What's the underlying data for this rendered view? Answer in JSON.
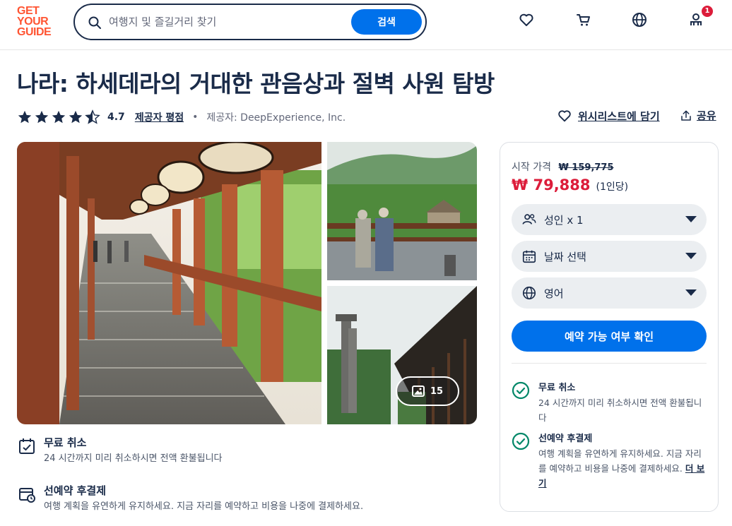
{
  "header": {
    "logo": [
      "GET",
      "YOUR",
      "GUIDE"
    ],
    "search_placeholder": "여행지 및 즐길거리 찾기",
    "search_button": "검색",
    "cart_badge": "1",
    "icons": [
      "heart-icon",
      "cart-icon",
      "globe-icon",
      "profile-icon"
    ]
  },
  "product": {
    "title": "나라: 하세데라의 거대한 관음상과 절벽 사원 탐방",
    "rating": "4.7",
    "rating_stars": 4.5,
    "rating_link": "제공자 평점",
    "provider": "제공자: DeepExperience, Inc.",
    "wishlist": "위시리스트에 담기",
    "share": "공유"
  },
  "gallery": {
    "photo_count": "15"
  },
  "features": {
    "free_cancel_title": "무료 취소",
    "free_cancel_desc": "24 시간까지 미리 취소하시면 전액 환불됩니다",
    "reserve_title": "선예약 후결제",
    "reserve_desc": "여행 계획을 유연하게 유지하세요. 지금 자리를 예약하고 비용을 나중에 결제하세요."
  },
  "booking": {
    "from_label": "시작 가격",
    "old_price": "₩ 159,775",
    "price": "₩ 79,888",
    "per_person": "(1인당)",
    "adults": "성인 x 1",
    "date": "날짜 선택",
    "language": "영어",
    "check_button": "예약 가능 여부 확인",
    "free_cancel_title": "무료 취소",
    "free_cancel_desc": "24 시간까지 미리 취소하시면 전액 환불됩니다",
    "reserve_title": "선예약 후결제",
    "reserve_desc": "여행 계획을 유연하게 유지하세요. 지금 자리를 예약하고 비용을 나중에 결제하세요.",
    "more_link": "더 보기"
  },
  "colors": {
    "brand": "#ff5533",
    "primary": "#0071eb",
    "price": "#dc1c3a",
    "text": "#1a2b49",
    "success": "#008768"
  }
}
